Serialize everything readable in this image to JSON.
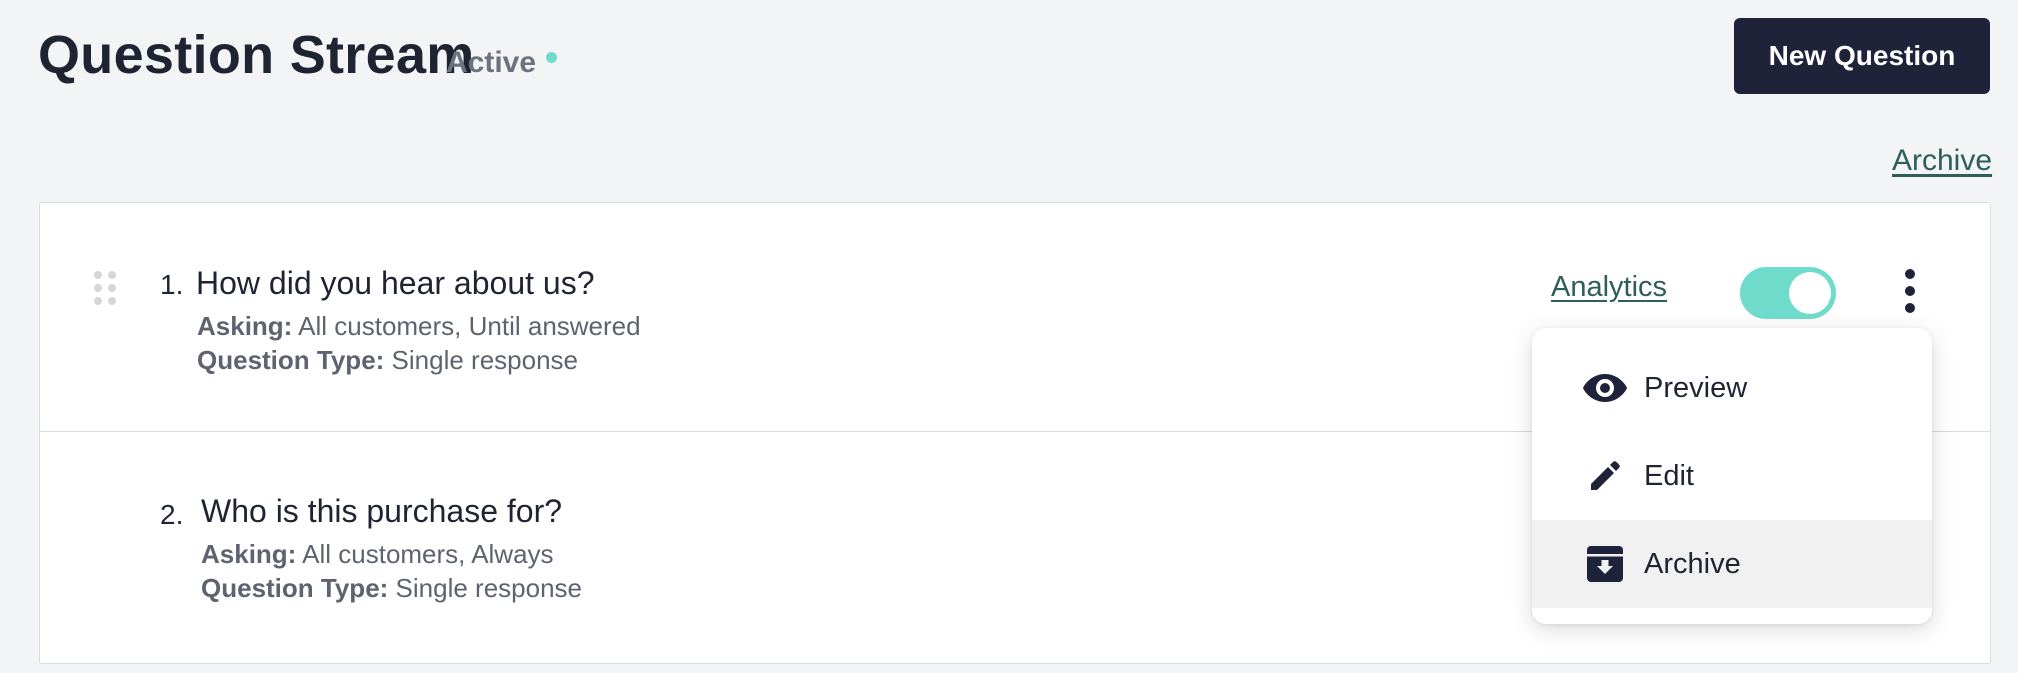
{
  "header": {
    "title": "Question Stream",
    "status": "Active",
    "new_question_label": "New Question"
  },
  "archive_link": "Archive",
  "questions": [
    {
      "number": "1.",
      "title": "How did you hear about us?",
      "asking_label": "Asking:",
      "asking_value": "All customers, Until answered",
      "type_label": "Question Type:",
      "type_value": "Single response",
      "analytics_label": "Analytics",
      "enabled": true
    },
    {
      "number": "2.",
      "title": "Who is this purchase for?",
      "asking_label": "Asking:",
      "asking_value": "All customers, Always",
      "type_label": "Question Type:",
      "type_value": "Single response"
    }
  ],
  "menu": {
    "items": [
      {
        "label": "Preview",
        "icon": "eye-icon"
      },
      {
        "label": "Edit",
        "icon": "pencil-icon"
      },
      {
        "label": "Archive",
        "icon": "archive-box-icon",
        "highlighted": true
      }
    ]
  },
  "colors": {
    "accent": "#6fdccb",
    "primary_button": "#1f2339",
    "link": "#2d5e57",
    "background": "#f3f4f6"
  }
}
